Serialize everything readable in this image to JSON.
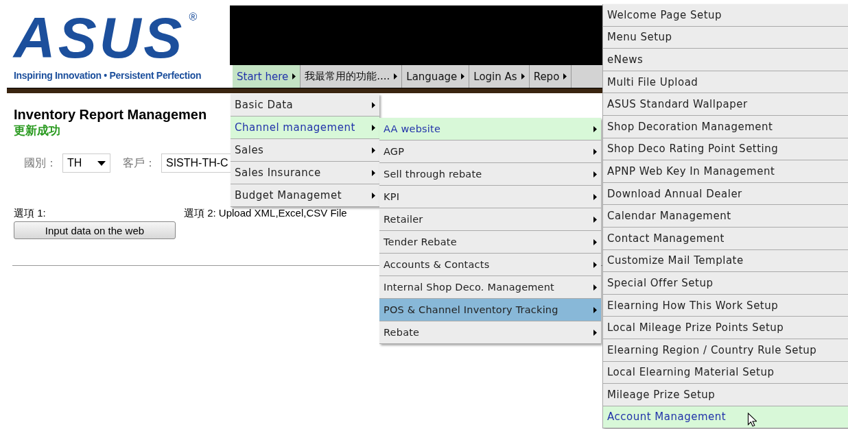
{
  "logo": {
    "wordmark": "ASUS",
    "registered": "®",
    "tagline": "Inspiring Innovation • Persistent Perfection"
  },
  "menubar": [
    {
      "label": "Start here",
      "selected": true
    },
    {
      "label": "我最常用的功能....",
      "selected": false
    },
    {
      "label": "Language",
      "selected": false
    },
    {
      "label": "Login As",
      "selected": false
    },
    {
      "label": "Repo",
      "selected": false
    }
  ],
  "page": {
    "title": "Inventory Report Managemen",
    "status": "更新成功",
    "country_label": "國別：",
    "country_value": "TH",
    "customer_label": "客戶：",
    "customer_value": "SISTH-TH-C",
    "option1_label": "選項 1:",
    "option1_button": "Input data on the web",
    "option2_label": "選項 2: Upload XML,Excel,CSV File"
  },
  "menus": [
    {
      "items": [
        {
          "label": "Basic Data",
          "has_submenu": true,
          "selected": false,
          "hovered": false
        },
        {
          "label": "Channel management",
          "has_submenu": true,
          "selected": true,
          "hovered": false
        },
        {
          "label": "Sales",
          "has_submenu": true,
          "selected": false,
          "hovered": false
        },
        {
          "label": "Sales Insurance",
          "has_submenu": true,
          "selected": false,
          "hovered": false
        },
        {
          "label": "Budget Managemet",
          "has_submenu": true,
          "selected": false,
          "hovered": false
        }
      ]
    },
    {
      "items": [
        {
          "label": "AA website",
          "has_submenu": true,
          "selected": true,
          "hovered": false
        },
        {
          "label": "AGP",
          "has_submenu": true,
          "selected": false,
          "hovered": false
        },
        {
          "label": "Sell through rebate",
          "has_submenu": true,
          "selected": false,
          "hovered": false
        },
        {
          "label": "KPI",
          "has_submenu": true,
          "selected": false,
          "hovered": false
        },
        {
          "label": "Retailer",
          "has_submenu": true,
          "selected": false,
          "hovered": false
        },
        {
          "label": "Tender Rebate",
          "has_submenu": true,
          "selected": false,
          "hovered": false
        },
        {
          "label": "Accounts & Contacts",
          "has_submenu": true,
          "selected": false,
          "hovered": false
        },
        {
          "label": "Internal Shop Deco. Management",
          "has_submenu": true,
          "selected": false,
          "hovered": false
        },
        {
          "label": "POS & Channel Inventory Tracking",
          "has_submenu": true,
          "selected": false,
          "hovered": true
        },
        {
          "label": "Rebate",
          "has_submenu": true,
          "selected": false,
          "hovered": false
        }
      ]
    },
    {
      "items": [
        {
          "label": "Welcome Page Setup",
          "has_submenu": false,
          "selected": false,
          "hovered": false
        },
        {
          "label": "Menu Setup",
          "has_submenu": false,
          "selected": false,
          "hovered": false
        },
        {
          "label": "eNews",
          "has_submenu": false,
          "selected": false,
          "hovered": false
        },
        {
          "label": "Multi File Upload",
          "has_submenu": false,
          "selected": false,
          "hovered": false
        },
        {
          "label": "ASUS Standard Wallpaper",
          "has_submenu": false,
          "selected": false,
          "hovered": false
        },
        {
          "label": "Shop Decoration Management",
          "has_submenu": false,
          "selected": false,
          "hovered": false
        },
        {
          "label": "Shop Deco Rating Point Setting",
          "has_submenu": false,
          "selected": false,
          "hovered": false
        },
        {
          "label": "APNP Web Key In Management",
          "has_submenu": false,
          "selected": false,
          "hovered": false
        },
        {
          "label": "Download Annual Dealer",
          "has_submenu": false,
          "selected": false,
          "hovered": false
        },
        {
          "label": "Calendar Management",
          "has_submenu": false,
          "selected": false,
          "hovered": false
        },
        {
          "label": "Contact Management",
          "has_submenu": false,
          "selected": false,
          "hovered": false
        },
        {
          "label": "Customize Mail Template",
          "has_submenu": false,
          "selected": false,
          "hovered": false
        },
        {
          "label": "Special Offer Setup",
          "has_submenu": false,
          "selected": false,
          "hovered": false
        },
        {
          "label": "Elearning How This Work Setup",
          "has_submenu": false,
          "selected": false,
          "hovered": false
        },
        {
          "label": "Local Mileage Prize Points Setup",
          "has_submenu": false,
          "selected": false,
          "hovered": false
        },
        {
          "label": "Elearning Region / Country Rule Setup",
          "has_submenu": false,
          "selected": false,
          "hovered": false
        },
        {
          "label": "Local Elearning Material Setup",
          "has_submenu": false,
          "selected": false,
          "hovered": false
        },
        {
          "label": "Mileage Prize Setup",
          "has_submenu": false,
          "selected": false,
          "hovered": false
        },
        {
          "label": "Account Management",
          "has_submenu": false,
          "selected": true,
          "hovered": false
        }
      ]
    }
  ]
}
